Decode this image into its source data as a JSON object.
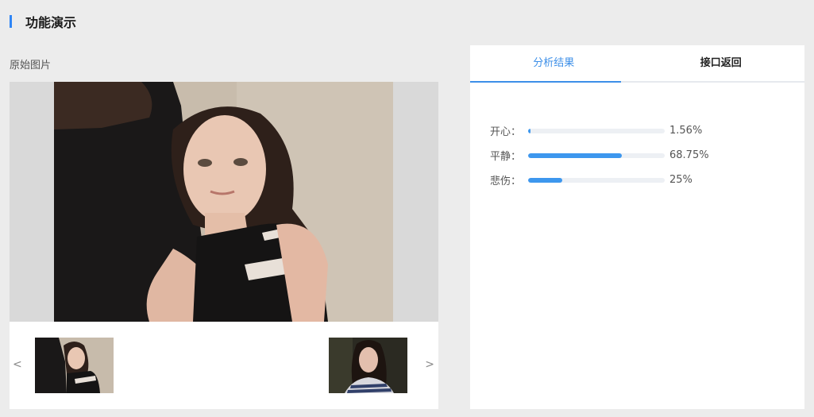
{
  "header": {
    "title": "功能演示"
  },
  "left": {
    "label": "原始图片",
    "prev_arrow": "<",
    "next_arrow": ">"
  },
  "tabs": [
    {
      "label": "分析结果",
      "active": true
    },
    {
      "label": "接口返回",
      "active": false
    }
  ],
  "results": [
    {
      "label": "开心：",
      "value_text": "1.56%",
      "percent": 1.56
    },
    {
      "label": "平静：",
      "value_text": "68.75%",
      "percent": 68.75
    },
    {
      "label": "悲伤：",
      "value_text": "25%",
      "percent": 25
    }
  ],
  "colors": {
    "accent": "#3d8fe8",
    "bar": "#3d97ee",
    "track": "#edf0f4"
  }
}
